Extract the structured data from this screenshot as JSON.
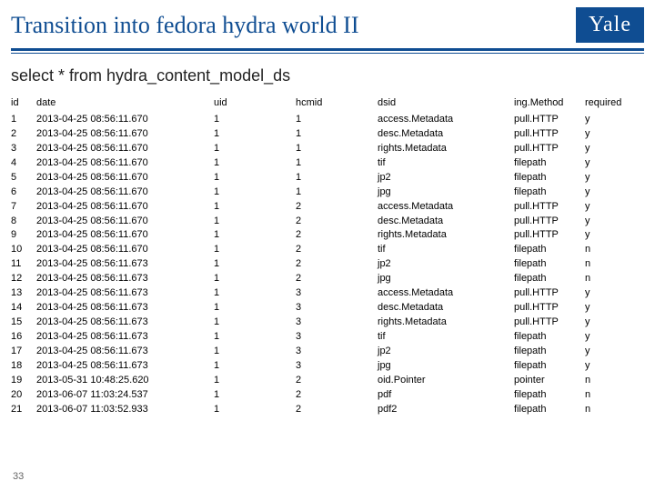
{
  "header": {
    "title": "Transition into fedora hydra world II",
    "logo_text": "Yale"
  },
  "query": "select * from hydra_content_model_ds",
  "columns": {
    "id": "id",
    "date": "date",
    "uid": "uid",
    "hcmid": "hcmid",
    "dsid": "dsid",
    "method": "ing.Method",
    "required": "required"
  },
  "rows": [
    {
      "id": "1",
      "date": "2013-04-25 08:56:11.670",
      "uid": "1",
      "hcmid": "1",
      "dsid": "access.Metadata",
      "method": "pull.HTTP",
      "required": "y"
    },
    {
      "id": "2",
      "date": "2013-04-25 08:56:11.670",
      "uid": "1",
      "hcmid": "1",
      "dsid": "desc.Metadata",
      "method": "pull.HTTP",
      "required": "y"
    },
    {
      "id": "3",
      "date": "2013-04-25 08:56:11.670",
      "uid": "1",
      "hcmid": "1",
      "dsid": "rights.Metadata",
      "method": "pull.HTTP",
      "required": "y"
    },
    {
      "id": "4",
      "date": "2013-04-25 08:56:11.670",
      "uid": "1",
      "hcmid": "1",
      "dsid": "tif",
      "method": "filepath",
      "required": "y"
    },
    {
      "id": "5",
      "date": "2013-04-25 08:56:11.670",
      "uid": "1",
      "hcmid": "1",
      "dsid": "jp2",
      "method": "filepath",
      "required": "y"
    },
    {
      "id": "6",
      "date": "2013-04-25 08:56:11.670",
      "uid": "1",
      "hcmid": "1",
      "dsid": "jpg",
      "method": "filepath",
      "required": "y"
    },
    {
      "id": "7",
      "date": "2013-04-25 08:56:11.670",
      "uid": "1",
      "hcmid": "2",
      "dsid": "access.Metadata",
      "method": "pull.HTTP",
      "required": "y"
    },
    {
      "id": "8",
      "date": "2013-04-25 08:56:11.670",
      "uid": "1",
      "hcmid": "2",
      "dsid": "desc.Metadata",
      "method": "pull.HTTP",
      "required": "y"
    },
    {
      "id": "9",
      "date": "2013-04-25 08:56:11.670",
      "uid": "1",
      "hcmid": "2",
      "dsid": "rights.Metadata",
      "method": "pull.HTTP",
      "required": "y"
    },
    {
      "id": "10",
      "date": "2013-04-25 08:56:11.670",
      "uid": "1",
      "hcmid": "2",
      "dsid": "tif",
      "method": "filepath",
      "required": "n"
    },
    {
      "id": "11",
      "date": "2013-04-25 08:56:11.673",
      "uid": "1",
      "hcmid": "2",
      "dsid": "jp2",
      "method": "filepath",
      "required": "n"
    },
    {
      "id": "12",
      "date": "2013-04-25 08:56:11.673",
      "uid": "1",
      "hcmid": "2",
      "dsid": "jpg",
      "method": "filepath",
      "required": "n"
    },
    {
      "id": "13",
      "date": "2013-04-25 08:56:11.673",
      "uid": "1",
      "hcmid": "3",
      "dsid": "access.Metadata",
      "method": "pull.HTTP",
      "required": "y"
    },
    {
      "id": "14",
      "date": "2013-04-25 08:56:11.673",
      "uid": "1",
      "hcmid": "3",
      "dsid": "desc.Metadata",
      "method": "pull.HTTP",
      "required": "y"
    },
    {
      "id": "15",
      "date": "2013-04-25 08:56:11.673",
      "uid": "1",
      "hcmid": "3",
      "dsid": "rights.Metadata",
      "method": "pull.HTTP",
      "required": "y"
    },
    {
      "id": "16",
      "date": "2013-04-25 08:56:11.673",
      "uid": "1",
      "hcmid": "3",
      "dsid": "tif",
      "method": "filepath",
      "required": "y"
    },
    {
      "id": "17",
      "date": "2013-04-25 08:56:11.673",
      "uid": "1",
      "hcmid": "3",
      "dsid": "jp2",
      "method": "filepath",
      "required": "y"
    },
    {
      "id": "18",
      "date": "2013-04-25 08:56:11.673",
      "uid": "1",
      "hcmid": "3",
      "dsid": "jpg",
      "method": "filepath",
      "required": "y"
    },
    {
      "id": "19",
      "date": "2013-05-31 10:48:25.620",
      "uid": "1",
      "hcmid": "2",
      "dsid": "oid.Pointer",
      "method": "pointer",
      "required": "n"
    },
    {
      "id": "20",
      "date": "2013-06-07 11:03:24.537",
      "uid": "1",
      "hcmid": "2",
      "dsid": "pdf",
      "method": "filepath",
      "required": "n"
    },
    {
      "id": "21",
      "date": "2013-06-07 11:03:52.933",
      "uid": "1",
      "hcmid": "2",
      "dsid": "pdf2",
      "method": "filepath",
      "required": "n"
    }
  ],
  "page_number": "33"
}
